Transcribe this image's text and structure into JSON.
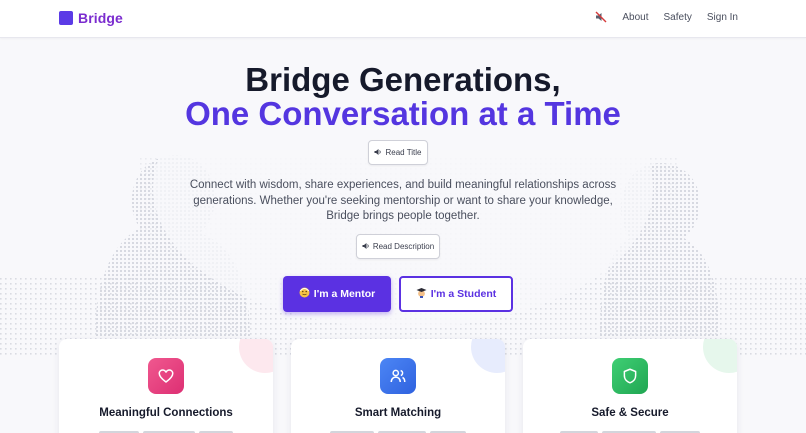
{
  "header": {
    "brand": "Bridge",
    "nav": [
      {
        "label": "About"
      },
      {
        "label": "Safety"
      },
      {
        "label": "Sign In"
      }
    ]
  },
  "hero": {
    "title_line1": "Bridge Generations,",
    "title_line2": "One Conversation at a Time",
    "read_title_label": "Read Title",
    "description": "Connect with wisdom, share experiences, and build meaningful relationships across generations. Whether you're seeking mentorship or want to share your knowledge, Bridge brings people together.",
    "read_description_label": "Read Description",
    "mentor_button": "I'm a Mentor",
    "student_button": "I'm a Student"
  },
  "features": [
    {
      "title": "Meaningful Connections",
      "icon": "heart-icon"
    },
    {
      "title": "Smart Matching",
      "icon": "users-icon"
    },
    {
      "title": "Safe & Secure",
      "icon": "shield-icon"
    }
  ],
  "colors": {
    "brand": "#5b31e2",
    "title_dark": "#161a2b",
    "title_accent": "#5436e0",
    "pink": "#dd2f73",
    "blue": "#2f62df",
    "green": "#20a652"
  }
}
